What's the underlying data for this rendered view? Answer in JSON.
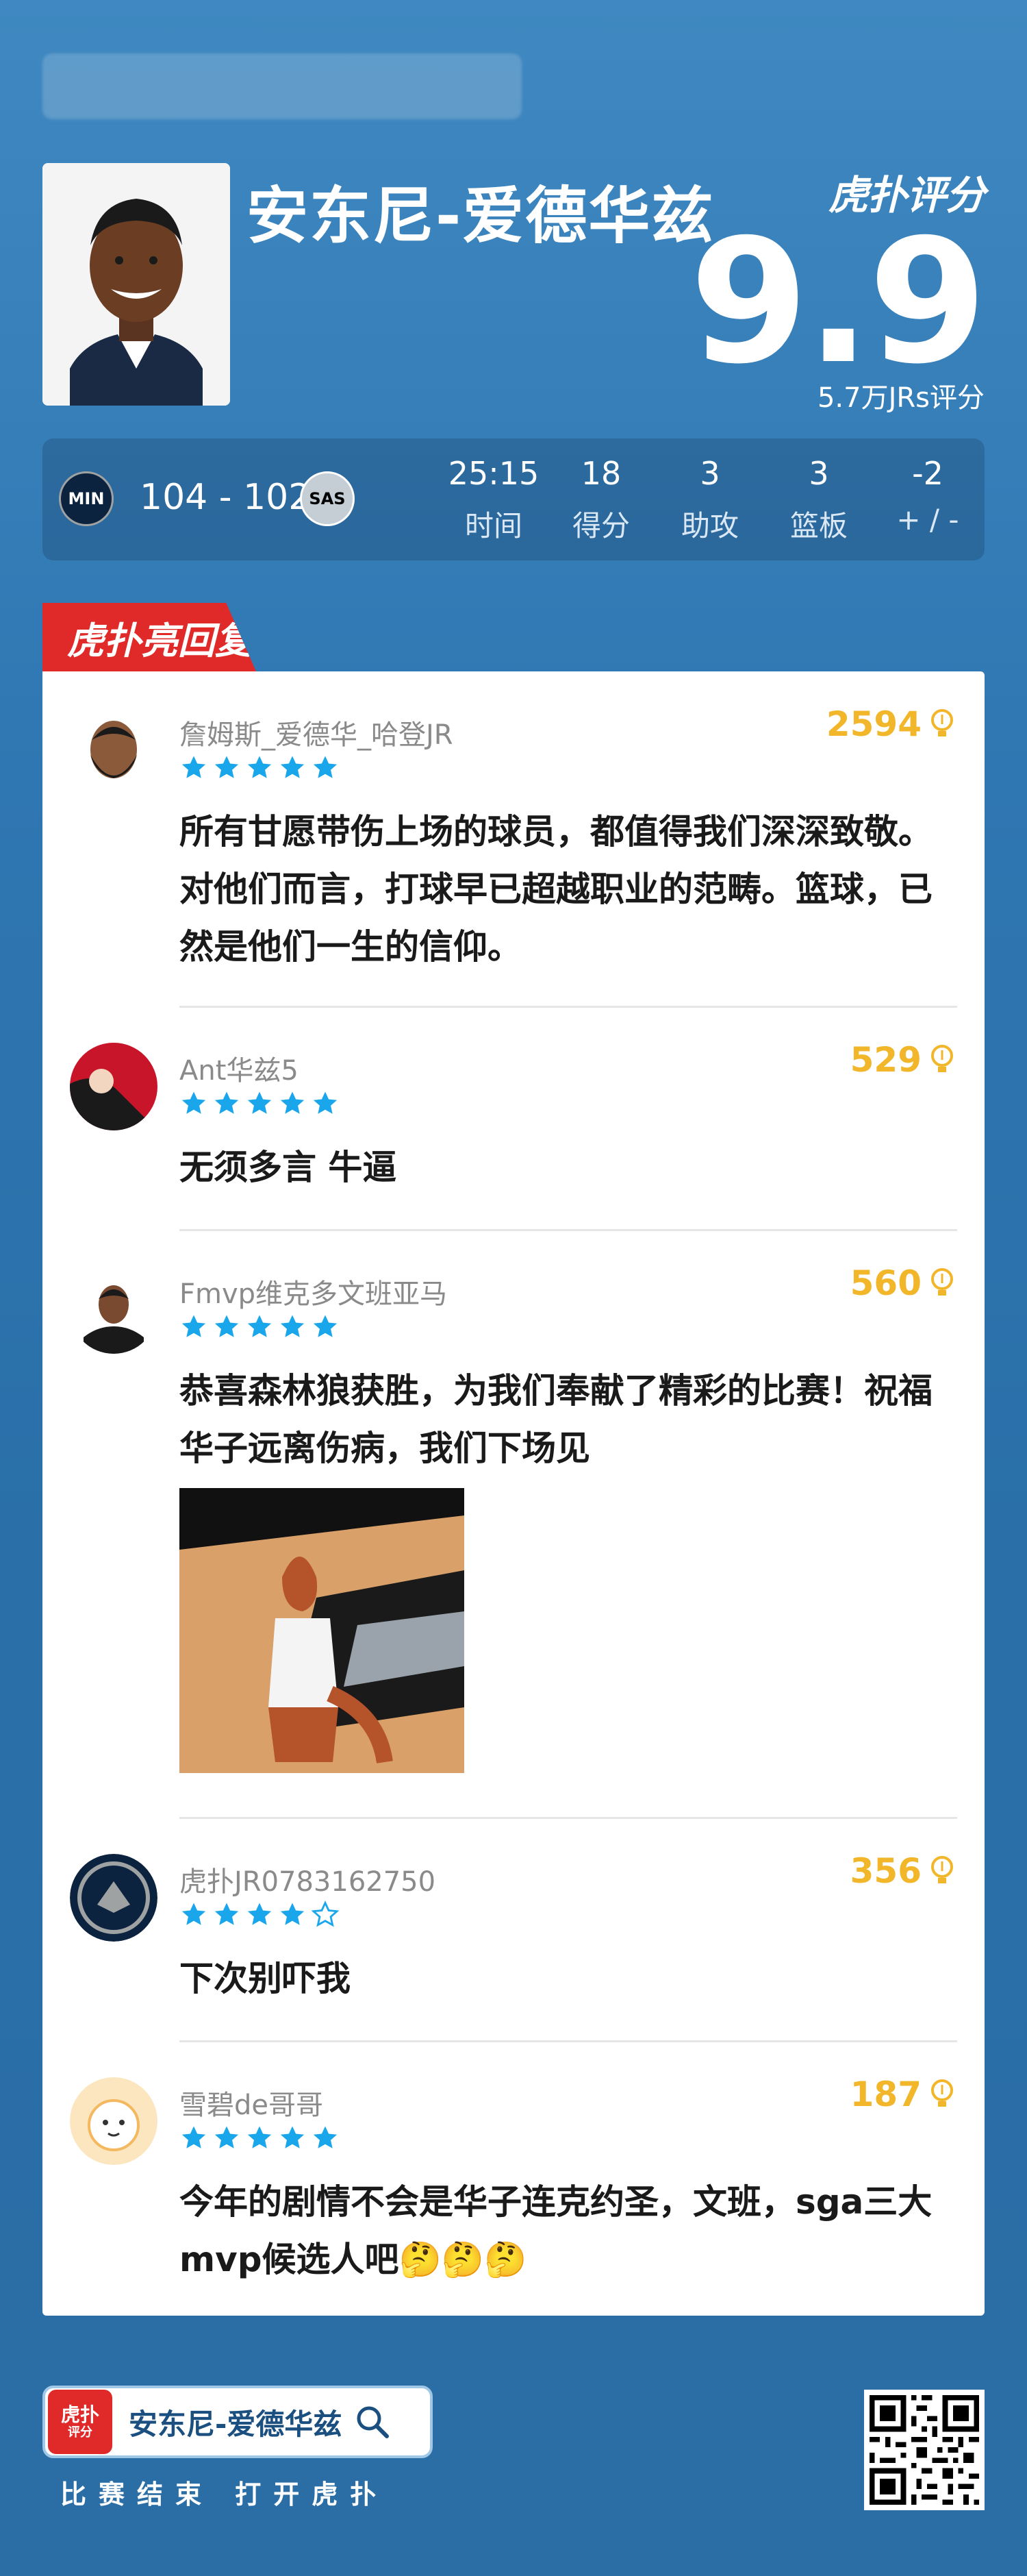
{
  "header": {
    "player_name": "安东尼-爱德华兹",
    "brand": "虎扑评分",
    "score": "9.9",
    "score_sub": "5.7万JRs评分"
  },
  "game": {
    "home_team": "MIN",
    "away_team": "SAS",
    "score": "104 - 102",
    "stats": [
      {
        "value": "25:15",
        "label": "时间"
      },
      {
        "value": "18",
        "label": "得分"
      },
      {
        "value": "3",
        "label": "助攻"
      },
      {
        "value": "3",
        "label": "篮板"
      },
      {
        "value": "-2",
        "label": "+ / -"
      }
    ]
  },
  "section_tag": "虎扑亮回复",
  "comments": [
    {
      "user": "詹姆斯_爱德华_哈登JR",
      "stars": 5,
      "likes": "2594",
      "text": "所有甘愿带伤上场的球员，都值得我们深深致敬。 对他们而言，打球早已超越职业的范畴。篮球，已然是他们一生的信仰。"
    },
    {
      "user": "Ant华兹5",
      "stars": 5,
      "likes": "529",
      "text": "无须多言 牛逼"
    },
    {
      "user": "Fmvp维克多文班亚马",
      "stars": 5,
      "likes": "560",
      "text": "恭喜森林狼获胜，为我们奉献了精彩的比赛！祝福华子远离伤病，我们下场见"
    },
    {
      "user": "虎扑JR0783162750",
      "stars": 4,
      "likes": "356",
      "text": "下次别吓我"
    },
    {
      "user": "雪碧de哥哥",
      "stars": 5,
      "likes": "187",
      "text": "今年的剧情不会是华子连克约圣，文班，sga三大mvp候选人吧🤔🤔🤔"
    }
  ],
  "footer": {
    "logo_top": "虎扑",
    "logo_bottom": "评分",
    "search_text": "安东尼-爱德华兹",
    "caption": "比赛结束 打开虎扑"
  },
  "colors": {
    "background": "#2f77b2",
    "tag_red": "#e02a2a",
    "likes_gold": "#f2b62b",
    "star_blue": "#1aa6ea"
  },
  "icons": {
    "search": "search-icon",
    "like": "lightbulb-icon",
    "star": "star-icon"
  }
}
